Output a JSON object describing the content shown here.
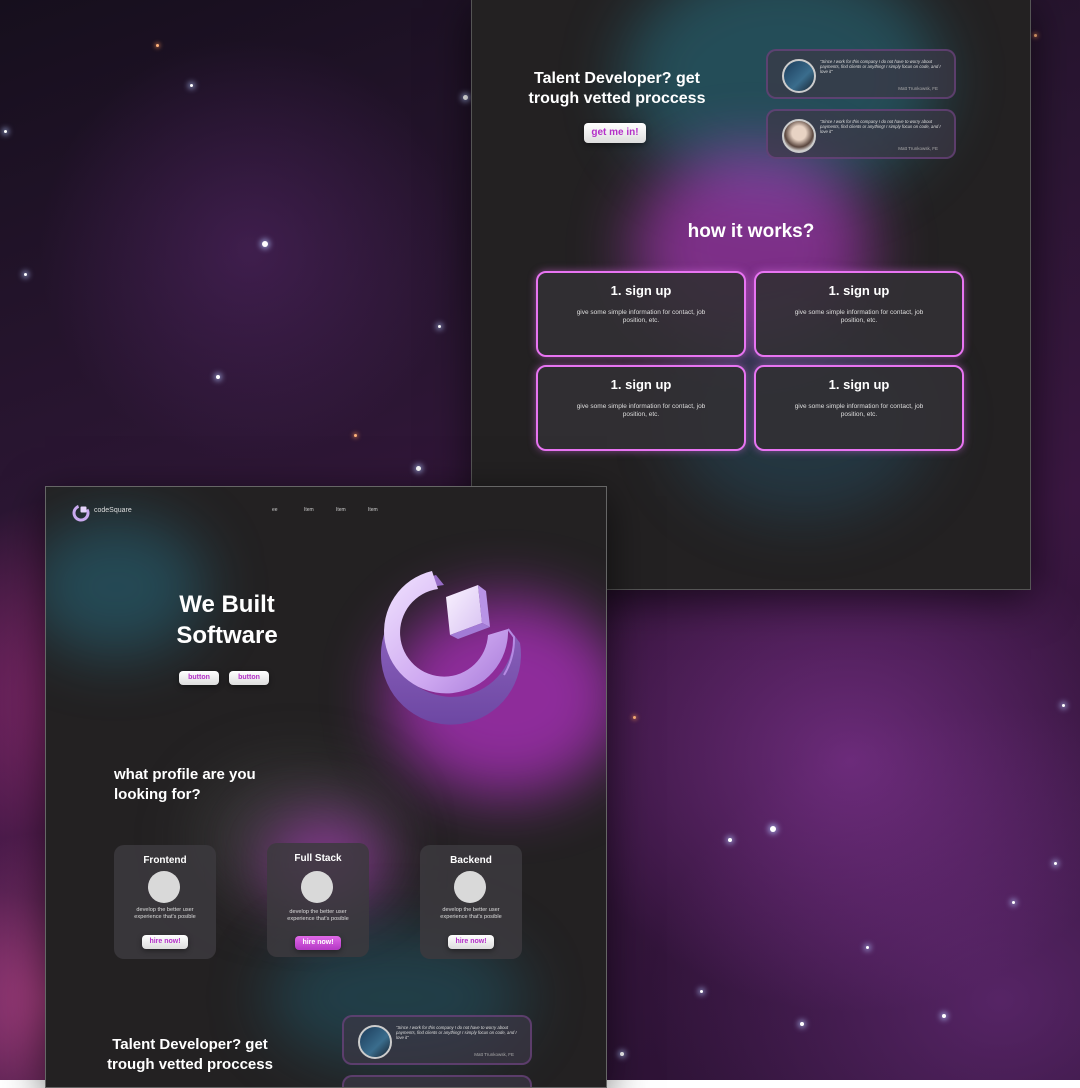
{
  "top_panel": {
    "cta_heading": "Talent Developer? get trough vetted proccess",
    "cta_button": "get me in!",
    "testimonials": [
      {
        "quote": "\"Since I work for this company I do not have to worry about payments, find clients or anything! I simply focus on code, and I love it\"",
        "name": "Matt Trunkowsk, FE"
      },
      {
        "quote": "\"Since I work for this company I do not have to worry about payments, find clients or anything! I simply focus on code, and I love it\"",
        "name": "Matt Trunkowsk, FE"
      }
    ],
    "how_heading": "how it works?",
    "steps": [
      {
        "title": "1. sign up",
        "desc": "give some simple information for contact, job position, etc."
      },
      {
        "title": "1. sign up",
        "desc": "give some simple information for contact, job position, etc."
      },
      {
        "title": "1. sign up",
        "desc": "give some simple information for contact, job position, etc."
      },
      {
        "title": "1. sign up",
        "desc": "give some simple information for contact, job position, etc."
      }
    ]
  },
  "bottom_panel": {
    "brand": "codeSquare",
    "nav": [
      "ee",
      "Item",
      "Item",
      "Item"
    ],
    "hero_line1": "We Built",
    "hero_line2": "Software",
    "hero_buttons": [
      "button",
      "button"
    ],
    "profile_heading": "what profile are you looking for?",
    "profiles": [
      {
        "title": "Frontend",
        "desc": "develop the better user experience that's posible",
        "button": "hire now!"
      },
      {
        "title": "Full Stack",
        "desc": "develop the better user experience that's posible",
        "button": "hire now!"
      },
      {
        "title": "Backend",
        "desc": "develop the better user experience that's posible",
        "button": "hire now!"
      }
    ],
    "cta_heading": "Talent Developer? get trough vetted proccess",
    "testimonial": {
      "quote": "\"Since I work for this company I do not have to worry about payments, find clients or anything! I simply focus on code, and I love it\"",
      "name": "Matt Trunkowsk, FE"
    }
  },
  "colors": {
    "accent": "#b42fc8",
    "step_border": "#e874f2",
    "panel_bg": "#232122"
  }
}
